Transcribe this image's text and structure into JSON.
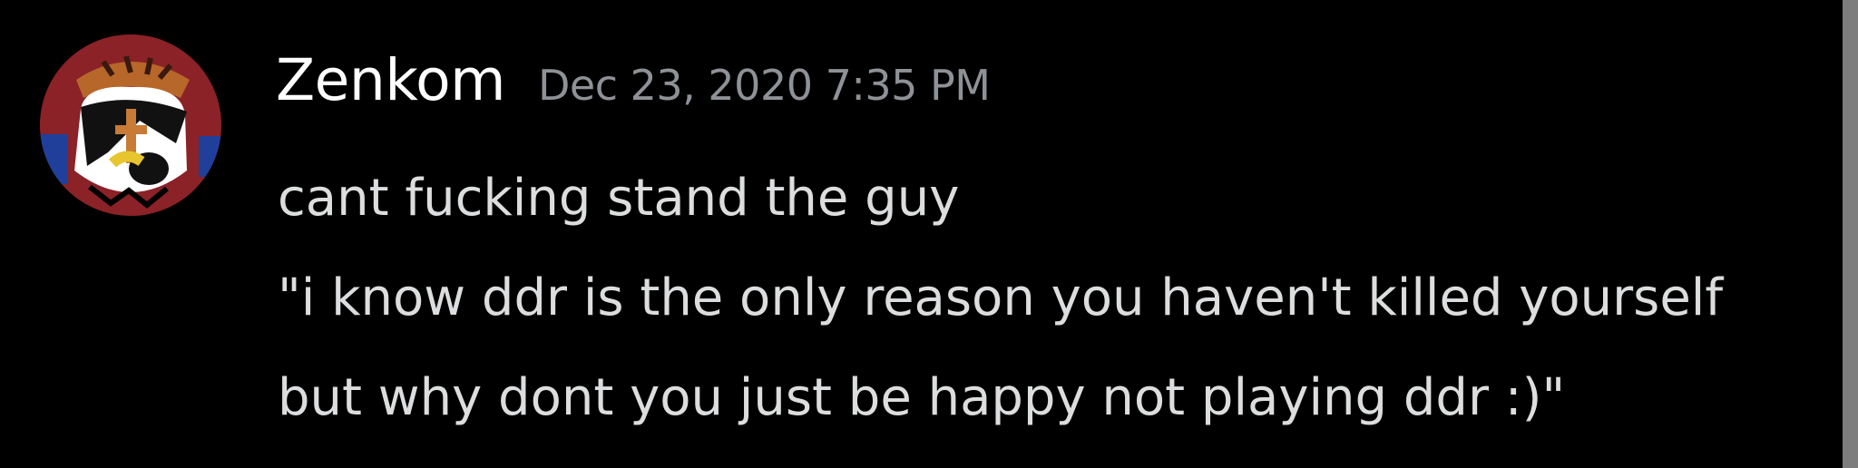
{
  "message": {
    "author": "Zenkom",
    "timestamp": "Dec 23, 2020 7:35 PM",
    "lines": [
      "cant fucking stand the guy",
      "\"i know ddr is the only reason you haven't killed yourself",
      "but why dont you just be happy not playing ddr :)\""
    ]
  },
  "colors": {
    "background": "#000000",
    "username": "#ffffff",
    "timestamp": "#8e9297",
    "message_text": "#dcddde",
    "scrollbar": "#7d7d7d"
  },
  "icons": {
    "avatar": "user-avatar-icon"
  }
}
